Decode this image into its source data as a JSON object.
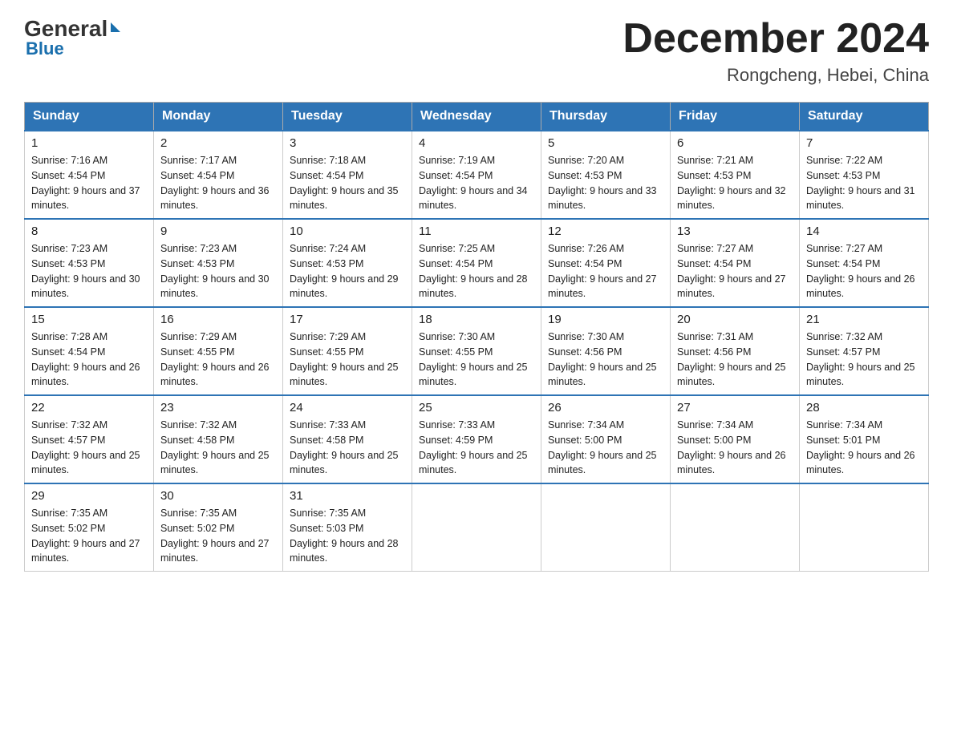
{
  "logo": {
    "general": "General",
    "blue": "Blue",
    "subtitle": "Blue"
  },
  "header": {
    "month_title": "December 2024",
    "location": "Rongcheng, Hebei, China"
  },
  "days_of_week": [
    "Sunday",
    "Monday",
    "Tuesday",
    "Wednesday",
    "Thursday",
    "Friday",
    "Saturday"
  ],
  "weeks": [
    [
      {
        "day": "1",
        "sunrise": "7:16 AM",
        "sunset": "4:54 PM",
        "daylight": "9 hours and 37 minutes."
      },
      {
        "day": "2",
        "sunrise": "7:17 AM",
        "sunset": "4:54 PM",
        "daylight": "9 hours and 36 minutes."
      },
      {
        "day": "3",
        "sunrise": "7:18 AM",
        "sunset": "4:54 PM",
        "daylight": "9 hours and 35 minutes."
      },
      {
        "day": "4",
        "sunrise": "7:19 AM",
        "sunset": "4:54 PM",
        "daylight": "9 hours and 34 minutes."
      },
      {
        "day": "5",
        "sunrise": "7:20 AM",
        "sunset": "4:53 PM",
        "daylight": "9 hours and 33 minutes."
      },
      {
        "day": "6",
        "sunrise": "7:21 AM",
        "sunset": "4:53 PM",
        "daylight": "9 hours and 32 minutes."
      },
      {
        "day": "7",
        "sunrise": "7:22 AM",
        "sunset": "4:53 PM",
        "daylight": "9 hours and 31 minutes."
      }
    ],
    [
      {
        "day": "8",
        "sunrise": "7:23 AM",
        "sunset": "4:53 PM",
        "daylight": "9 hours and 30 minutes."
      },
      {
        "day": "9",
        "sunrise": "7:23 AM",
        "sunset": "4:53 PM",
        "daylight": "9 hours and 30 minutes."
      },
      {
        "day": "10",
        "sunrise": "7:24 AM",
        "sunset": "4:53 PM",
        "daylight": "9 hours and 29 minutes."
      },
      {
        "day": "11",
        "sunrise": "7:25 AM",
        "sunset": "4:54 PM",
        "daylight": "9 hours and 28 minutes."
      },
      {
        "day": "12",
        "sunrise": "7:26 AM",
        "sunset": "4:54 PM",
        "daylight": "9 hours and 27 minutes."
      },
      {
        "day": "13",
        "sunrise": "7:27 AM",
        "sunset": "4:54 PM",
        "daylight": "9 hours and 27 minutes."
      },
      {
        "day": "14",
        "sunrise": "7:27 AM",
        "sunset": "4:54 PM",
        "daylight": "9 hours and 26 minutes."
      }
    ],
    [
      {
        "day": "15",
        "sunrise": "7:28 AM",
        "sunset": "4:54 PM",
        "daylight": "9 hours and 26 minutes."
      },
      {
        "day": "16",
        "sunrise": "7:29 AM",
        "sunset": "4:55 PM",
        "daylight": "9 hours and 26 minutes."
      },
      {
        "day": "17",
        "sunrise": "7:29 AM",
        "sunset": "4:55 PM",
        "daylight": "9 hours and 25 minutes."
      },
      {
        "day": "18",
        "sunrise": "7:30 AM",
        "sunset": "4:55 PM",
        "daylight": "9 hours and 25 minutes."
      },
      {
        "day": "19",
        "sunrise": "7:30 AM",
        "sunset": "4:56 PM",
        "daylight": "9 hours and 25 minutes."
      },
      {
        "day": "20",
        "sunrise": "7:31 AM",
        "sunset": "4:56 PM",
        "daylight": "9 hours and 25 minutes."
      },
      {
        "day": "21",
        "sunrise": "7:32 AM",
        "sunset": "4:57 PM",
        "daylight": "9 hours and 25 minutes."
      }
    ],
    [
      {
        "day": "22",
        "sunrise": "7:32 AM",
        "sunset": "4:57 PM",
        "daylight": "9 hours and 25 minutes."
      },
      {
        "day": "23",
        "sunrise": "7:32 AM",
        "sunset": "4:58 PM",
        "daylight": "9 hours and 25 minutes."
      },
      {
        "day": "24",
        "sunrise": "7:33 AM",
        "sunset": "4:58 PM",
        "daylight": "9 hours and 25 minutes."
      },
      {
        "day": "25",
        "sunrise": "7:33 AM",
        "sunset": "4:59 PM",
        "daylight": "9 hours and 25 minutes."
      },
      {
        "day": "26",
        "sunrise": "7:34 AM",
        "sunset": "5:00 PM",
        "daylight": "9 hours and 25 minutes."
      },
      {
        "day": "27",
        "sunrise": "7:34 AM",
        "sunset": "5:00 PM",
        "daylight": "9 hours and 26 minutes."
      },
      {
        "day": "28",
        "sunrise": "7:34 AM",
        "sunset": "5:01 PM",
        "daylight": "9 hours and 26 minutes."
      }
    ],
    [
      {
        "day": "29",
        "sunrise": "7:35 AM",
        "sunset": "5:02 PM",
        "daylight": "9 hours and 27 minutes."
      },
      {
        "day": "30",
        "sunrise": "7:35 AM",
        "sunset": "5:02 PM",
        "daylight": "9 hours and 27 minutes."
      },
      {
        "day": "31",
        "sunrise": "7:35 AM",
        "sunset": "5:03 PM",
        "daylight": "9 hours and 28 minutes."
      },
      null,
      null,
      null,
      null
    ]
  ]
}
